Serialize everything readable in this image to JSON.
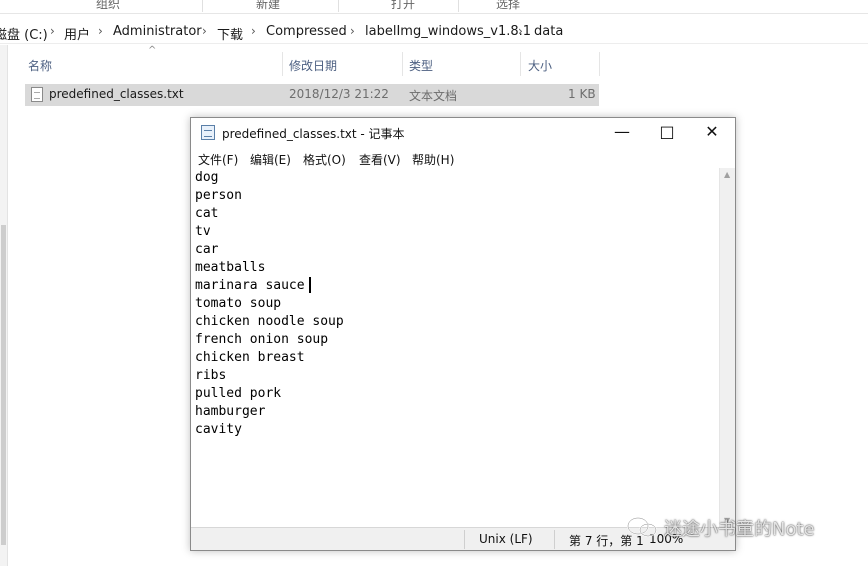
{
  "ribbon": {
    "groups": [
      "组织",
      "新建",
      "打开",
      "选择"
    ]
  },
  "breadcrumb": {
    "items": [
      "磁盘 (C:)",
      "用户",
      "Administrator",
      "下载",
      "Compressed",
      "labelImg_windows_v1.8.1",
      "data"
    ]
  },
  "file_list": {
    "columns": [
      "名称",
      "修改日期",
      "类型",
      "大小"
    ],
    "rows": [
      {
        "name": "predefined_classes.txt",
        "modified": "2018/12/3 21:22",
        "type": "文本文档",
        "size": "1 KB"
      }
    ]
  },
  "notepad": {
    "title": "predefined_classes.txt - 记事本",
    "menu": [
      "文件(F)",
      "编辑(E)",
      "格式(O)",
      "查看(V)",
      "帮助(H)"
    ],
    "lines": [
      "dog",
      "person",
      "cat",
      "tv",
      "car",
      "meatballs",
      "marinara sauce",
      "tomato soup",
      "chicken noodle soup",
      "french onion soup",
      "chicken breast",
      "ribs",
      "pulled pork",
      "hamburger",
      "cavity"
    ],
    "status": {
      "line_ending": "Unix (LF)",
      "position": "第 7 行，第 1",
      "zoom": "100%"
    }
  },
  "watermark": {
    "text": "迷途小书童的Note"
  },
  "icons": {
    "file": "text-file-icon",
    "notepad": "notepad-icon",
    "minimize": "minimize-icon",
    "maximize": "maximize-icon",
    "close": "close-icon",
    "wechat": "wechat-icon"
  }
}
